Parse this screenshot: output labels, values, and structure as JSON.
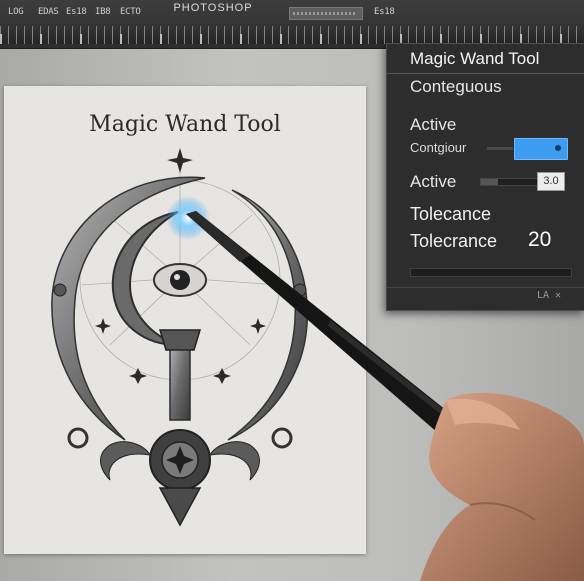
{
  "app": {
    "title": "PHOTOSHOP",
    "toolbar_items": [
      "LOG",
      "EDAS",
      "Es18",
      "IB8",
      "ECTO",
      "Es18"
    ]
  },
  "document": {
    "title": "Magic Wand Tool"
  },
  "panel": {
    "title": "Magic Wand Tool",
    "contiguous_label": "Conteguous",
    "active_label_1": "Active",
    "contiguous_label_2": "Contgiour",
    "active_label_2": "Active",
    "number_box_value": "3.0",
    "tolerance_label_1": "Tolecance",
    "tolerance_label_2": "Tolecrance",
    "tolerance_value": "20",
    "footer_text": "LA ✕"
  },
  "colors": {
    "toggle_accent": "#3d9bf0",
    "panel_bg": "#2d2d2d",
    "toolbar_bg": "#2f2f2f"
  },
  "icons": [
    "wand-glow-icon",
    "star-icon",
    "eye-icon",
    "crescent-moon-icon"
  ]
}
